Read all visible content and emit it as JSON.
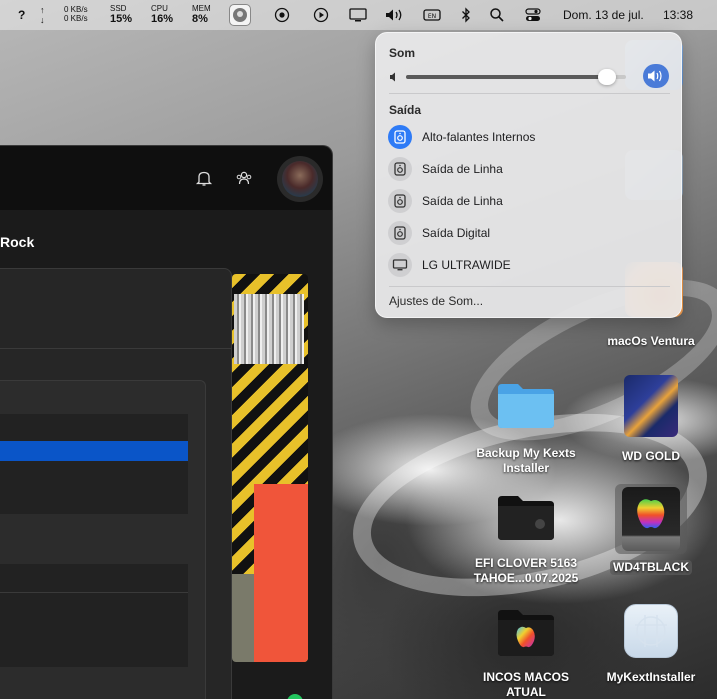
{
  "menubar": {
    "help": "?",
    "net_up": "0 KB/s",
    "net_down": "0 KB/s",
    "ssd_label": "SSD",
    "ssd_value": "15%",
    "cpu_label": "CPU",
    "cpu_value": "16%",
    "mem_label": "MEM",
    "mem_value": "8%",
    "date": "Dom. 13 de jul.",
    "time": "13:38",
    "icons": [
      "help-icon",
      "network-arrows-icon",
      "app-icon",
      "record-icon",
      "play-icon",
      "display-icon",
      "volume-icon",
      "keyboard-icon",
      "bluetooth-icon",
      "search-icon",
      "control-center-icon"
    ]
  },
  "window": {
    "title": "Rock"
  },
  "sound": {
    "heading": "Som",
    "volume_percent": 95,
    "output_heading": "Saída",
    "devices": [
      {
        "label": "Alto-falantes Internos",
        "active": true
      },
      {
        "label": "Saída de Linha",
        "active": false
      },
      {
        "label": "Saída de Linha",
        "active": false
      },
      {
        "label": "Saída Digital",
        "active": false
      },
      {
        "label": "LG ULTRAWIDE",
        "active": false
      }
    ],
    "settings": "Ajustes de Som..."
  },
  "desktop": {
    "items": [
      {
        "label": "macOs Ventura"
      },
      {
        "label": "Backup My Kexts\nInstaller"
      },
      {
        "label": "WD GOLD"
      },
      {
        "label": "EFI CLOVER 5163\nTAHOE...0.07.2025"
      },
      {
        "label": "WD4TBLACK"
      },
      {
        "label": "INCOS MACOS\nATUAL"
      },
      {
        "label": "MyKextInstaller"
      }
    ]
  },
  "colors": {
    "accent": "#2e7bf6",
    "folder": "#5ab4f0"
  }
}
